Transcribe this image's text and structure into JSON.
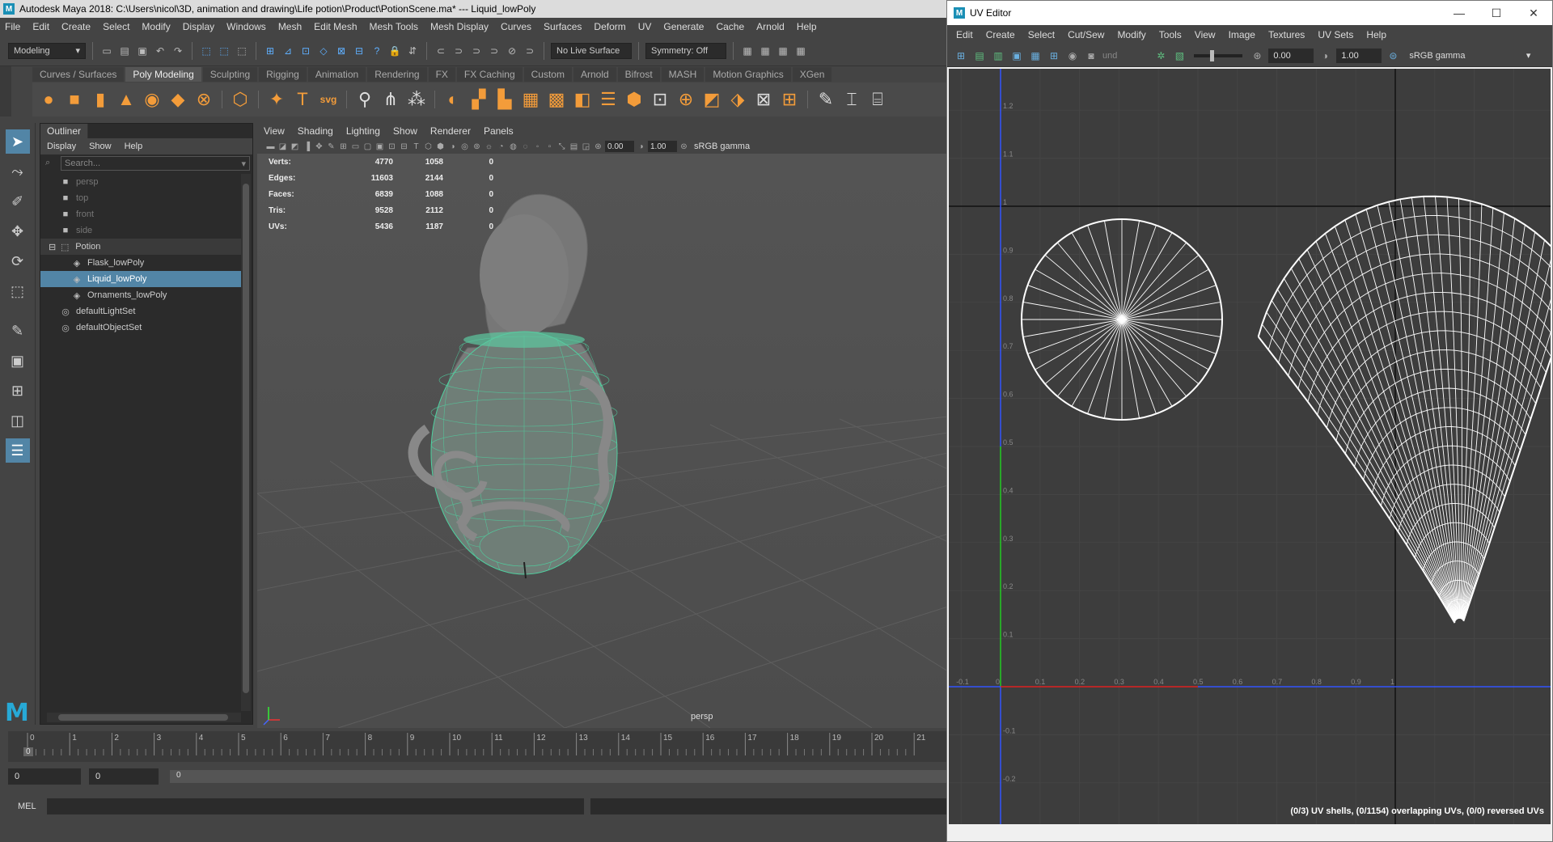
{
  "maya": {
    "title": "Autodesk Maya 2018: C:\\Users\\nicol\\3D, animation and drawing\\Life potion\\Product\\PotionScene.ma*   ---   Liquid_lowPoly",
    "menus": [
      "File",
      "Edit",
      "Create",
      "Select",
      "Modify",
      "Display",
      "Windows",
      "Mesh",
      "Edit Mesh",
      "Mesh Tools",
      "Mesh Display",
      "Curves",
      "Surfaces",
      "Deform",
      "UV",
      "Generate",
      "Cache",
      "Arnold",
      "Help"
    ],
    "mode_selector": "Modeling",
    "live_surface": "No Live Surface",
    "symmetry": "Symmetry: Off",
    "shelf_tabs": [
      "Curves / Surfaces",
      "Poly Modeling",
      "Sculpting",
      "Rigging",
      "Animation",
      "Rendering",
      "FX",
      "FX Caching",
      "Custom",
      "Arnold",
      "Bifrost",
      "MASH",
      "Motion Graphics",
      "XGen"
    ],
    "active_shelf_tab": "Poly Modeling"
  },
  "outliner": {
    "tab": "Outliner",
    "menus": [
      "Display",
      "Show",
      "Help"
    ],
    "search_placeholder": "Search...",
    "items": [
      {
        "label": "persp",
        "indent": 1,
        "icon": "camera-icon",
        "dim": true
      },
      {
        "label": "top",
        "indent": 1,
        "icon": "camera-icon",
        "dim": true
      },
      {
        "label": "front",
        "indent": 1,
        "icon": "camera-icon",
        "dim": true
      },
      {
        "label": "side",
        "indent": 1,
        "icon": "camera-icon",
        "dim": true
      },
      {
        "label": "Potion",
        "indent": 0,
        "icon": "group-icon",
        "group": true
      },
      {
        "label": "Flask_lowPoly",
        "indent": 2,
        "icon": "mesh-icon"
      },
      {
        "label": "Liquid_lowPoly",
        "indent": 2,
        "icon": "mesh-icon",
        "selected": true
      },
      {
        "label": "Ornaments_lowPoly",
        "indent": 2,
        "icon": "mesh-icon"
      },
      {
        "label": "defaultLightSet",
        "indent": 1,
        "icon": "set-icon"
      },
      {
        "label": "defaultObjectSet",
        "indent": 1,
        "icon": "set-icon"
      }
    ]
  },
  "viewport": {
    "menus": [
      "View",
      "Shading",
      "Lighting",
      "Show",
      "Renderer",
      "Panels"
    ],
    "exposure": "0.00",
    "gamma": "1.00",
    "color_space": "sRGB gamma",
    "camera": "persp",
    "hud": [
      {
        "label": "Verts:",
        "a": "4770",
        "b": "1058",
        "c": "0"
      },
      {
        "label": "Edges:",
        "a": "11603",
        "b": "2144",
        "c": "0"
      },
      {
        "label": "Faces:",
        "a": "6839",
        "b": "1088",
        "c": "0"
      },
      {
        "label": "Tris:",
        "a": "9528",
        "b": "2112",
        "c": "0"
      },
      {
        "label": "UVs:",
        "a": "5436",
        "b": "1187",
        "c": "0"
      }
    ]
  },
  "timeline": {
    "ticks": [
      "0",
      "1",
      "2",
      "3",
      "4",
      "5",
      "6",
      "7",
      "8",
      "9",
      "10",
      "11",
      "12",
      "13",
      "14",
      "15",
      "16",
      "17",
      "18",
      "19",
      "20",
      "21"
    ],
    "current_frame": "0",
    "range_start": "0",
    "range_inner_start": "0",
    "range_bar_value": "0"
  },
  "mel": {
    "label": "MEL"
  },
  "uv_editor": {
    "title": "UV Editor",
    "menus": [
      "Edit",
      "Create",
      "Select",
      "Cut/Sew",
      "Modify",
      "Tools",
      "View",
      "Image",
      "Textures",
      "UV Sets",
      "Help"
    ],
    "toolbar_label": "und",
    "exposure": "0.00",
    "gamma": "1.00",
    "color_space": "sRGB gamma",
    "v_ticks": [
      "1.2",
      "1.1",
      "1",
      "0.9",
      "0.8",
      "0.7",
      "0.6",
      "0.5",
      "0.4",
      "0.3",
      "0.2",
      "0.1",
      "-0.1",
      "-0.2"
    ],
    "u_ticks": [
      "-0.1",
      "0",
      "0.1",
      "0.2",
      "0.3",
      "0.4",
      "0.5",
      "0.6",
      "0.7",
      "0.8",
      "0.9",
      "1"
    ],
    "status": "(0/3) UV shells, (0/1154) overlapping UVs, (0/0) reversed UVs"
  }
}
